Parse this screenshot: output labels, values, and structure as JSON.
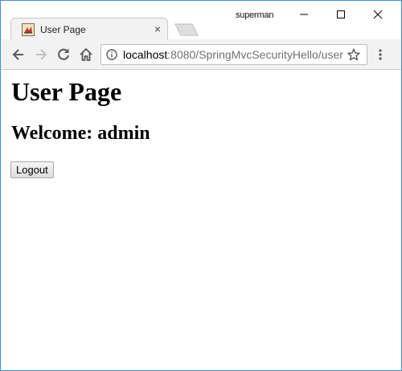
{
  "browser": {
    "tab_title": "User Page",
    "tab_close": "×",
    "profile_name": "superman",
    "url_host": "localhost",
    "url_rest": ":8080/SpringMvcSecurityHello/user",
    "icons": {
      "back": "arrow-left-icon",
      "forward": "arrow-right-icon",
      "reload": "reload-icon",
      "home": "home-icon",
      "info": "info-icon",
      "bookmark": "star-icon",
      "menu": "kebab-menu-icon"
    }
  },
  "page": {
    "title": "User Page",
    "welcome": "Welcome: admin",
    "logout_label": "Logout"
  },
  "colors": {
    "window_border": "#3b8fd6",
    "toolbar_bg": "#f2f2f2",
    "url_rest": "#707070"
  }
}
